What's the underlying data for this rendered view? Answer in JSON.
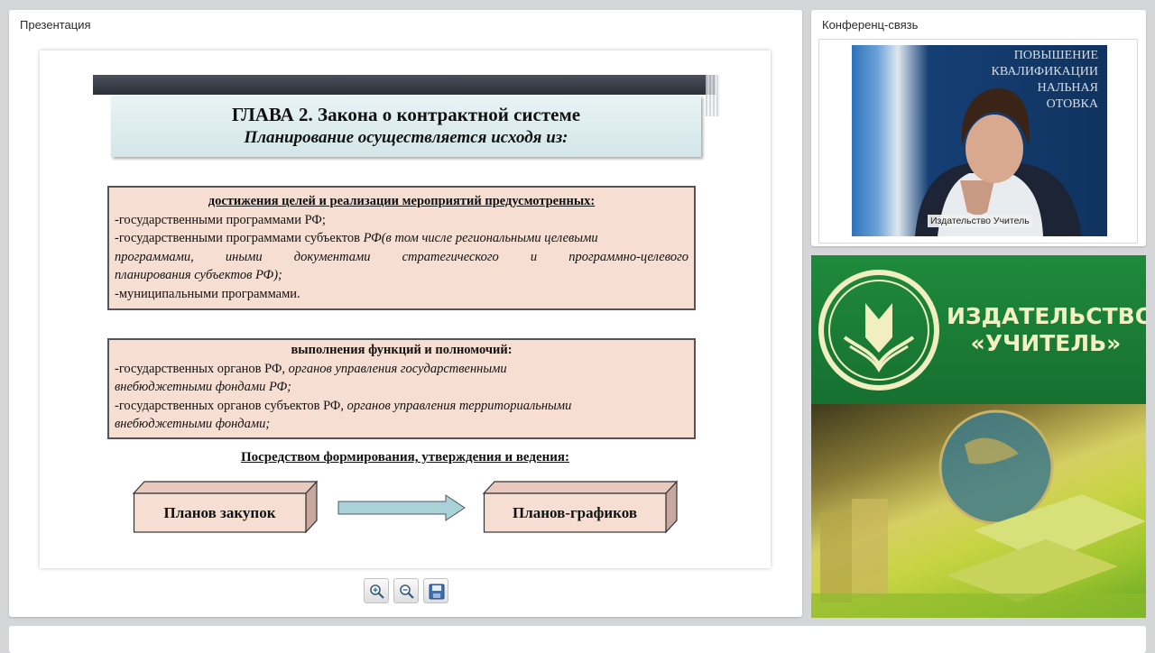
{
  "presentation_panel": {
    "title": "Презентация"
  },
  "conference_panel": {
    "title": "Конференц-связь"
  },
  "slide": {
    "title_line1": "ГЛАВА 2. Закона о контрактной системе",
    "title_line2": "Планирование осуществляется исходя из:",
    "box1": {
      "heading": "достижения целей и реализации мероприятий предусмотренных:",
      "line1": "-государственными программами РФ;",
      "line2_normal": "-государственными программами субъектов ",
      "line2_italic": "РФ(в том числе региональными целевыми",
      "line3": "программами, иными документами стратегического и программно-целевого",
      "line4": "планирования субъектов РФ);",
      "line5": "-муниципальными программами."
    },
    "box2": {
      "heading": "выполнения функций и полномочий:",
      "line1_normal": "-государственных органов РФ, ",
      "line1_italic": "органов управления государственными",
      "line2": "внебюджетными фондами РФ;",
      "line3_normal": "-государственных органов субъектов РФ, ",
      "line3_italic": "органов управления территориальными",
      "line4": "внебюджетными фондами;"
    },
    "means_heading": "Посредством формирования, утверждения и ведения:",
    "cube_left": "Планов закупок",
    "cube_right": "Планов-графиков"
  },
  "toolbar": {
    "buttons": [
      "zoom-in-icon",
      "zoom-out-icon",
      "save-icon"
    ]
  },
  "video": {
    "background_text": [
      "ПОВЫШЕНИЕ",
      "КВАЛИФИКАЦИИ",
      "НАЛЬНАЯ",
      "ОТОВКА"
    ],
    "caption": "Издательство Учитель"
  },
  "ad": {
    "title_line1": "ИЗДАТЕЛЬСТВО",
    "title_line2": "«УЧИТЕЛЬ»"
  },
  "colors": {
    "accent_green": "#1e7a36",
    "box_fill": "#f6dfd2",
    "title_fill": "#d3e6e8",
    "arrow_fill": "#a9d2d8"
  }
}
